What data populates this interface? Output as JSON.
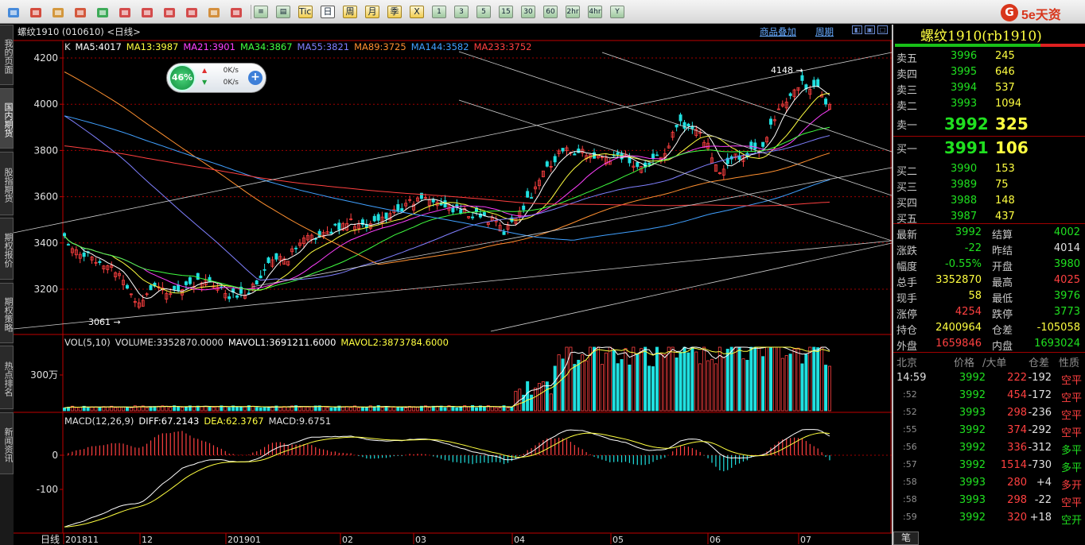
{
  "toolbar": {
    "icons": [
      "back-icon",
      "home-icon",
      "list-icon",
      "f10-icon",
      "refresh-icon",
      "zoom-in-icon",
      "zoom-out-icon",
      "window-icon",
      "draw-icon",
      "tools-icon",
      "filter-icon"
    ],
    "buttons": [
      "Tick",
      "日",
      "周",
      "月",
      "季",
      "X",
      "1",
      "3",
      "5",
      "15",
      "30",
      "60",
      "2hr",
      "4hr",
      "Y"
    ],
    "selected": "日",
    "logo": "5e天资"
  },
  "left_tabs": [
    "我的页面",
    "国内期货",
    "股指期货",
    "期权报价",
    "期权策略",
    "热点排名",
    "新闻资讯"
  ],
  "chart": {
    "title": "螺纹1910 (010610) <日线>",
    "link_products": "商品叠加",
    "link_period": "周期",
    "ma_prefix": "K",
    "ma": [
      {
        "label": "MA5:4017",
        "color": "#ffffff"
      },
      {
        "label": "MA13:3987",
        "color": "#ffff40"
      },
      {
        "label": "MA21:3901",
        "color": "#ff40ff"
      },
      {
        "label": "MA34:3867",
        "color": "#40ff40"
      },
      {
        "label": "MA55:3821",
        "color": "#8080ff"
      },
      {
        "label": "MA89:3725",
        "color": "#ff9030"
      },
      {
        "label": "MA144:3582",
        "color": "#40a0ff"
      },
      {
        "label": "MA233:3752",
        "color": "#ff4040"
      }
    ],
    "price_ticks": [
      "4200",
      "4000",
      "3800",
      "3600",
      "3400",
      "3200"
    ],
    "high_label": "4148",
    "low_label": "3061",
    "widget": {
      "percent": "46%",
      "up": "0K/s",
      "down": "0K/s"
    },
    "vol_header": [
      {
        "label": "VOL(5,10)",
        "color": "#e0e0e0"
      },
      {
        "label": "VOLUME:3352870.0000",
        "color": "#e0e0e0"
      },
      {
        "label": "MAVOL1:3691211.6000",
        "color": "#ffffff"
      },
      {
        "label": "MAVOL2:3873784.6000",
        "color": "#ffff40"
      }
    ],
    "vol_tick": "300万",
    "macd_header": [
      {
        "label": "MACD(12,26,9)",
        "color": "#e0e0e0"
      },
      {
        "label": "DIFF:67.2143",
        "color": "#ffffff"
      },
      {
        "label": "DEA:62.3767",
        "color": "#ffff40"
      },
      {
        "label": "MACD:9.6751",
        "color": "#e0e0e0"
      }
    ],
    "macd_ticks": [
      "0",
      "-100"
    ],
    "date_label": "日线",
    "dates": [
      "201811",
      "12",
      "201901",
      "02",
      "03",
      "04",
      "05",
      "06",
      "07"
    ]
  },
  "panel": {
    "title": "螺纹1910(rb1910)",
    "asks": [
      {
        "label": "卖五",
        "price": "3996",
        "vol": "245"
      },
      {
        "label": "卖四",
        "price": "3995",
        "vol": "646"
      },
      {
        "label": "卖三",
        "price": "3994",
        "vol": "537"
      },
      {
        "label": "卖二",
        "price": "3993",
        "vol": "1094"
      },
      {
        "label": "卖一",
        "price": "3992",
        "vol": "325"
      }
    ],
    "bids": [
      {
        "label": "买一",
        "price": "3991",
        "vol": "106"
      },
      {
        "label": "买二",
        "price": "3990",
        "vol": "153"
      },
      {
        "label": "买三",
        "price": "3989",
        "vol": "75"
      },
      {
        "label": "买四",
        "price": "3988",
        "vol": "148"
      },
      {
        "label": "买五",
        "price": "3987",
        "vol": "437"
      }
    ],
    "stats": [
      {
        "l1": "最新",
        "v1": "3992",
        "c1": "g",
        "l2": "结算",
        "v2": "4002",
        "c2": "g"
      },
      {
        "l1": "涨跌",
        "v1": "-22",
        "c1": "g",
        "l2": "昨结",
        "v2": "4014",
        "c2": "w"
      },
      {
        "l1": "幅度",
        "v1": "-0.55%",
        "c1": "g",
        "l2": "开盘",
        "v2": "3980",
        "c2": "g"
      },
      {
        "l1": "总手",
        "v1": "3352870",
        "c1": "y",
        "l2": "最高",
        "v2": "4025",
        "c2": "r"
      },
      {
        "l1": "现手",
        "v1": "58",
        "c1": "y",
        "l2": "最低",
        "v2": "3976",
        "c2": "g"
      },
      {
        "l1": "涨停",
        "v1": "4254",
        "c1": "r",
        "l2": "跌停",
        "v2": "3773",
        "c2": "g"
      },
      {
        "l1": "持仓",
        "v1": "2400964",
        "c1": "y",
        "l2": "仓差",
        "v2": "-105058",
        "c2": "y"
      },
      {
        "l1": "外盘",
        "v1": "1659846",
        "c1": "r",
        "l2": "内盘",
        "v2": "1693024",
        "c2": "g"
      }
    ],
    "trades_header": [
      "北京",
      "价格",
      "/大单",
      "仓差",
      "性质"
    ],
    "trades": [
      {
        "time": "14:59",
        "price": "3992",
        "vol": "222",
        "diff": "-192",
        "nature": "空平",
        "nc": "r"
      },
      {
        "time": ":52",
        "price": "3992",
        "vol": "454",
        "diff": "-172",
        "nature": "空平",
        "nc": "r"
      },
      {
        "time": ":52",
        "price": "3993",
        "vol": "298",
        "diff": "-236",
        "nature": "空平",
        "nc": "r"
      },
      {
        "time": ":55",
        "price": "3992",
        "vol": "374",
        "diff": "-292",
        "nature": "空平",
        "nc": "r"
      },
      {
        "time": ":56",
        "price": "3992",
        "vol": "336",
        "diff": "-312",
        "nature": "多平",
        "nc": "g"
      },
      {
        "time": ":57",
        "price": "3992",
        "vol": "1514",
        "diff": "-730",
        "nature": "多平",
        "nc": "g"
      },
      {
        "time": ":58",
        "price": "3993",
        "vol": "280",
        "diff": "+4",
        "nature": "多开",
        "nc": "r"
      },
      {
        "time": ":58",
        "price": "3993",
        "vol": "298",
        "diff": "-22",
        "nature": "空平",
        "nc": "r"
      },
      {
        "time": ":59",
        "price": "3992",
        "vol": "320",
        "diff": "+18",
        "nature": "空开",
        "nc": "g"
      }
    ],
    "bottom_tab": "笔"
  },
  "colors": {
    "up": "#ff4040",
    "down": "#20e0e0",
    "grid": "#a00000",
    "axis": "#c00000"
  }
}
